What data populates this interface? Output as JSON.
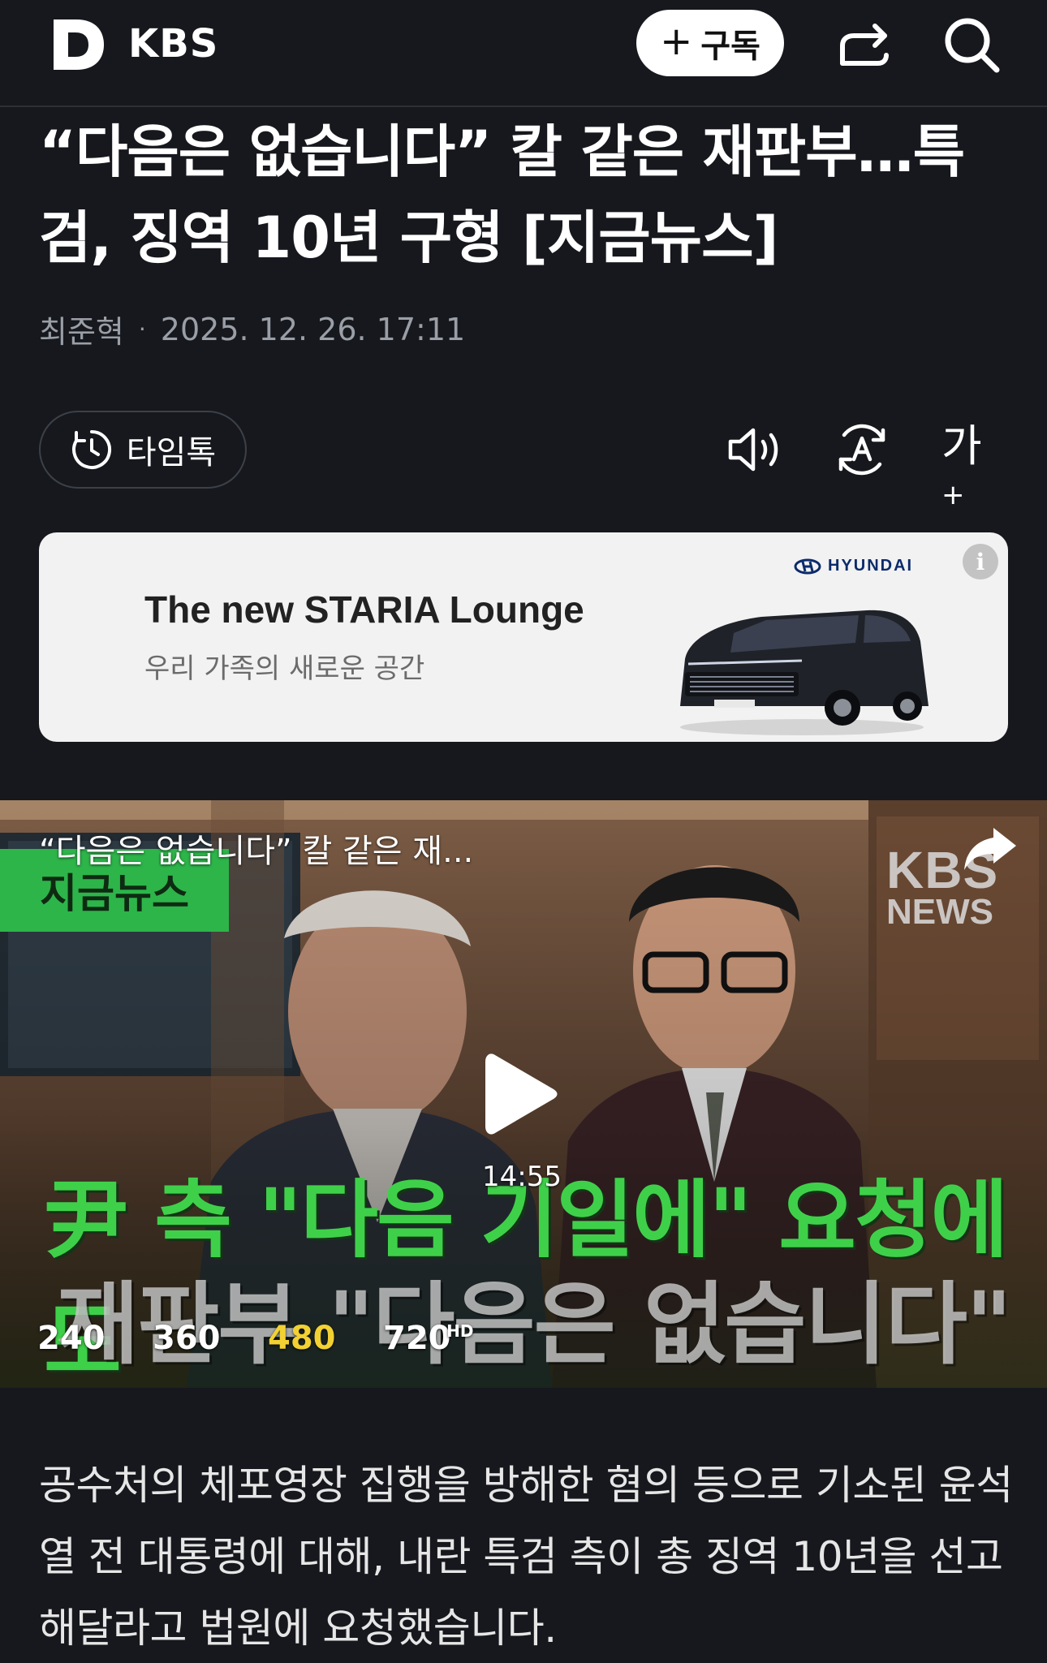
{
  "header": {
    "brand": "KBS",
    "subscribe_label": "구독",
    "subscribe_plus": "+"
  },
  "article": {
    "headline": "“다음은 없습니다” 칼 같은 재판부…특검, 징역 10년 구형 [지금뉴스]",
    "author": "최준혁",
    "separator": "·",
    "datetime": "2025. 12. 26. 17:11",
    "body": "공수처의 체포영장 집행을 방해한 혐의 등으로 기소된 윤석열 전 대통령에 대해, 내란 특검 측이 총 징역 10년을 선고해달라고 법원에 요청했습니다."
  },
  "toolbar": {
    "timetalk_label": "타임톡",
    "font_label": "가",
    "font_plus": "+"
  },
  "ad": {
    "title": "The new STARIA Lounge",
    "subtitle": "우리 가족의 새로운 공간",
    "brand": "HYUNDAI",
    "info_symbol": "i"
  },
  "video": {
    "title": "“다음은 없습니다” 칼 같은 재...",
    "channel_line1": "KBS",
    "channel_line2": "NEWS",
    "tag": "지금뉴스",
    "caption_line1": "尹 측 \"다음 기일에\" 요청에도",
    "caption_line2": "재판부 \"다음은 없습니다\"",
    "duration": "14:55",
    "qualities": [
      {
        "label": "240"
      },
      {
        "label": "360"
      },
      {
        "label": "480",
        "selected": true
      },
      {
        "label": "720",
        "badge": "HD"
      }
    ]
  },
  "colors": {
    "background": "#16181d",
    "quality_selected": "#f2d132",
    "caption_green": "#3fd04a"
  }
}
